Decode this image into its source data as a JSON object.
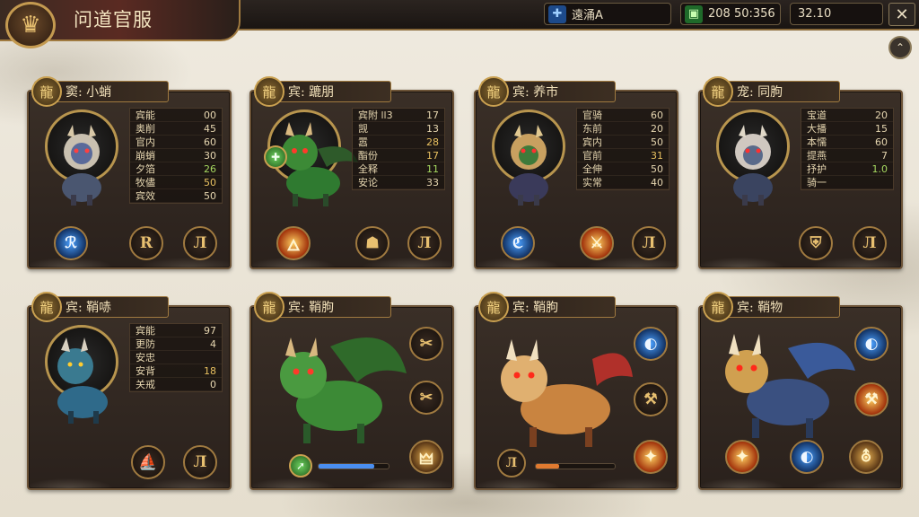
{
  "header": {
    "title": "问道官服",
    "emblem_icon": "dragon-crest-icon",
    "player_name": "遠涌A",
    "currency_value": "208 50:356",
    "level_value": "32.10"
  },
  "cards": [
    {
      "name": "窦: 小蛸",
      "stats": [
        {
          "k": "宾能",
          "v": "00",
          "tone": ""
        },
        {
          "k": "奥削",
          "v": "45",
          "tone": ""
        },
        {
          "k": "官内",
          "v": "60",
          "tone": ""
        },
        {
          "k": "崩蛸",
          "v": "30",
          "tone": ""
        },
        {
          "k": "夕箔",
          "v": "26",
          "tone": "green"
        },
        {
          "k": "牧儘",
          "v": "50",
          "tone": "gold"
        },
        {
          "k": "宾效",
          "v": "50",
          "tone": ""
        }
      ],
      "skills": [
        "ℛ",
        "R",
        "Л"
      ]
    },
    {
      "name": "宾: 蹗朋",
      "stats": [
        {
          "k": "宾附 ll3",
          "v": "17",
          "tone": ""
        },
        {
          "k": "觊",
          "v": "13",
          "tone": ""
        },
        {
          "k": "嚣",
          "v": "28",
          "tone": "gold"
        },
        {
          "k": "酯份",
          "v": "17",
          "tone": "gold"
        },
        {
          "k": "全释",
          "v": "11",
          "tone": "green"
        },
        {
          "k": "安论",
          "v": "33",
          "tone": ""
        }
      ],
      "skills": [
        "🜂",
        "☗",
        "Л"
      ]
    },
    {
      "name": "宾: 养市",
      "stats": [
        {
          "k": "官骑",
          "v": "60",
          "tone": ""
        },
        {
          "k": "东前",
          "v": "20",
          "tone": ""
        },
        {
          "k": "宾内",
          "v": "50",
          "tone": ""
        },
        {
          "k": "官前",
          "v": "31",
          "tone": "gold"
        },
        {
          "k": "全伸",
          "v": "50",
          "tone": ""
        },
        {
          "k": "实常",
          "v": "40",
          "tone": ""
        }
      ],
      "skills": [
        "ℭ",
        "⚔",
        "Л"
      ]
    },
    {
      "name": "宠: 同朐",
      "stats": [
        {
          "k": "宝道",
          "v": "20",
          "tone": ""
        },
        {
          "k": "大播",
          "v": "15",
          "tone": ""
        },
        {
          "k": "本懦",
          "v": "60",
          "tone": ""
        },
        {
          "k": "提燕",
          "v": "7",
          "tone": ""
        },
        {
          "k": "抒护",
          "v": "1.0",
          "tone": "green"
        },
        {
          "k": "骑一",
          "v": "",
          "tone": ""
        }
      ],
      "skills": [
        "⛨",
        "Л"
      ]
    },
    {
      "name": "宾: 鞘哧",
      "stats": [
        {
          "k": "宾能",
          "v": "97",
          "tone": ""
        },
        {
          "k": "更防",
          "v": "4",
          "tone": ""
        },
        {
          "k": "安忠",
          "v": "",
          "tone": ""
        },
        {
          "k": "安背",
          "v": "18",
          "tone": "gold"
        },
        {
          "k": "关戒",
          "v": "0",
          "tone": ""
        }
      ],
      "skills": [
        "⛵",
        "Л"
      ]
    },
    {
      "name": "宾: 鞘朐",
      "stats": [],
      "skills": [
        "✂",
        "✂",
        "🜲"
      ],
      "progress": 0.8
    },
    {
      "name": "宾: 鞘朐",
      "stats": [],
      "skills": [
        "◐",
        "⚒",
        "✦"
      ],
      "progress": 0.3
    },
    {
      "name": "宾: 鞘物",
      "stats": [],
      "skills": [
        "◐",
        "⚒",
        "✦",
        "◐",
        "⛢"
      ]
    }
  ],
  "colors": {
    "accent_gold": "#c9a050",
    "panel_dark": "#2a211c",
    "progress_blue": "#4a8ef0",
    "progress_orange": "#e07a30"
  }
}
